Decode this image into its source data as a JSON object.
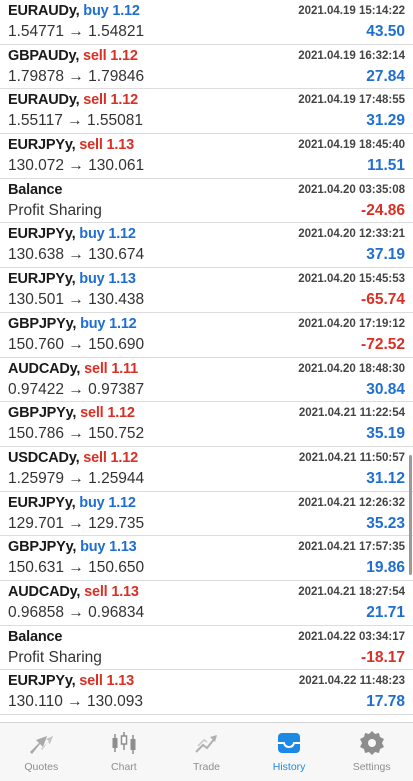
{
  "deals": [
    {
      "symbol": "EURAUDy,",
      "side": "buy",
      "lots": "1.12",
      "prices": "1.54771 → 1.54821",
      "time": "2021.04.19 15:14:22",
      "profit": "43.50",
      "profit_sign": "pos"
    },
    {
      "symbol": "GBPAUDy,",
      "side": "sell",
      "lots": "1.12",
      "prices": "1.79878 → 1.79846",
      "time": "2021.04.19 16:32:14",
      "profit": "27.84",
      "profit_sign": "pos"
    },
    {
      "symbol": "EURAUDy,",
      "side": "sell",
      "lots": "1.12",
      "prices": "1.55117 → 1.55081",
      "time": "2021.04.19 17:48:55",
      "profit": "31.29",
      "profit_sign": "pos"
    },
    {
      "symbol": "EURJPYy,",
      "side": "sell",
      "lots": "1.13",
      "prices": "130.072 → 130.061",
      "time": "2021.04.19 18:45:40",
      "profit": "11.51",
      "profit_sign": "pos"
    },
    {
      "symbol": "Balance",
      "side": "",
      "lots": "",
      "prices": "Profit Sharing",
      "time": "2021.04.20 03:35:08",
      "profit": "-24.86",
      "profit_sign": "neg"
    },
    {
      "symbol": "EURJPYy,",
      "side": "buy",
      "lots": "1.12",
      "prices": "130.638 → 130.674",
      "time": "2021.04.20 12:33:21",
      "profit": "37.19",
      "profit_sign": "pos"
    },
    {
      "symbol": "EURJPYy,",
      "side": "buy",
      "lots": "1.13",
      "prices": "130.501 → 130.438",
      "time": "2021.04.20 15:45:53",
      "profit": "-65.74",
      "profit_sign": "neg"
    },
    {
      "symbol": "GBPJPYy,",
      "side": "buy",
      "lots": "1.12",
      "prices": "150.760 → 150.690",
      "time": "2021.04.20 17:19:12",
      "profit": "-72.52",
      "profit_sign": "neg"
    },
    {
      "symbol": "AUDCADy,",
      "side": "sell",
      "lots": "1.11",
      "prices": "0.97422 → 0.97387",
      "time": "2021.04.20 18:48:30",
      "profit": "30.84",
      "profit_sign": "pos"
    },
    {
      "symbol": "GBPJPYy,",
      "side": "sell",
      "lots": "1.12",
      "prices": "150.786 → 150.752",
      "time": "2021.04.21 11:22:54",
      "profit": "35.19",
      "profit_sign": "pos"
    },
    {
      "symbol": "USDCADy,",
      "side": "sell",
      "lots": "1.12",
      "prices": "1.25979 → 1.25944",
      "time": "2021.04.21 11:50:57",
      "profit": "31.12",
      "profit_sign": "pos"
    },
    {
      "symbol": "EURJPYy,",
      "side": "buy",
      "lots": "1.12",
      "prices": "129.701 → 129.735",
      "time": "2021.04.21 12:26:32",
      "profit": "35.23",
      "profit_sign": "pos"
    },
    {
      "symbol": "GBPJPYy,",
      "side": "buy",
      "lots": "1.13",
      "prices": "150.631 → 150.650",
      "time": "2021.04.21 17:57:35",
      "profit": "19.86",
      "profit_sign": "pos"
    },
    {
      "symbol": "AUDCADy,",
      "side": "sell",
      "lots": "1.13",
      "prices": "0.96858 → 0.96834",
      "time": "2021.04.21 18:27:54",
      "profit": "21.71",
      "profit_sign": "pos"
    },
    {
      "symbol": "Balance",
      "side": "",
      "lots": "",
      "prices": "Profit Sharing",
      "time": "2021.04.22 03:34:17",
      "profit": "-18.17",
      "profit_sign": "neg"
    },
    {
      "symbol": "EURJPYy,",
      "side": "sell",
      "lots": "1.13",
      "prices": "130.110 → 130.093",
      "time": "2021.04.22 11:48:23",
      "profit": "17.78",
      "profit_sign": "pos"
    }
  ],
  "tabbar": {
    "tabs": [
      {
        "label": "Quotes",
        "icon": "quotes-icon"
      },
      {
        "label": "Chart",
        "icon": "chart-icon"
      },
      {
        "label": "Trade",
        "icon": "trade-icon"
      },
      {
        "label": "History",
        "icon": "history-icon"
      },
      {
        "label": "Settings",
        "icon": "settings-icon"
      }
    ],
    "active": "History"
  },
  "colors": {
    "buy": "#1f6fd1",
    "sell": "#d93025",
    "active_tab": "#1e88e5",
    "inactive_tab": "#8e8e8e"
  }
}
